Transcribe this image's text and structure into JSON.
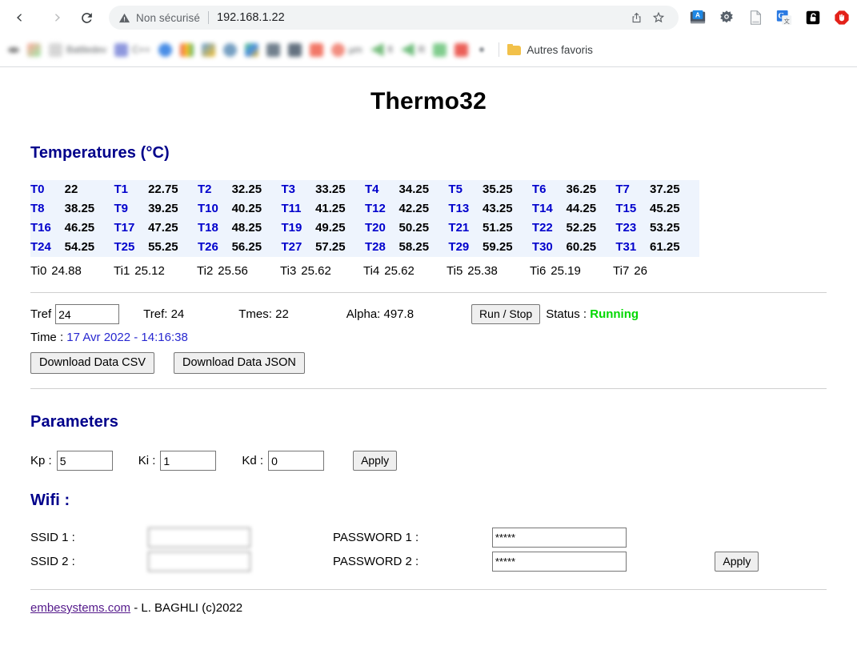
{
  "browser": {
    "nav": {
      "back_icon": "arrow-left-icon",
      "forward_icon": "arrow-right-icon",
      "reload_icon": "reload-icon"
    },
    "omnibox": {
      "warning_icon": "warning-triangle-icon",
      "security_text": "Non sécurisé",
      "url": "192.168.1.22",
      "share_icon": "share-icon",
      "bookmark_icon": "star-icon"
    },
    "extensions": [
      {
        "name": "grammar-extension-icon",
        "label": "A"
      },
      {
        "name": "bug-gear-extension-icon",
        "label": ""
      },
      {
        "name": "document-extension-icon",
        "label": ""
      },
      {
        "name": "google-translate-extension-icon",
        "label": "G"
      },
      {
        "name": "lock-extension-icon",
        "label": ""
      },
      {
        "name": "adblock-extension-icon",
        "label": ""
      },
      {
        "name": "privacy-badger-extension-icon",
        "label": ""
      },
      {
        "name": "puzzle-extensions-icon",
        "label": ""
      },
      {
        "name": "side-panel-icon",
        "label": ""
      }
    ],
    "profile_icon": "avatar",
    "menu_icon": "kebab-menu-icon",
    "bookmarks": [
      {
        "label": "",
        "color": "#6b6b6b"
      },
      {
        "label": "",
        "color": "#8fe39a"
      },
      {
        "label": "",
        "color": "#b9b9b9"
      },
      {
        "label": "Battledev",
        "color": "#9a9a9a"
      },
      {
        "label": "",
        "color": "#7b86d8"
      },
      {
        "label": "C++",
        "color": "#8b8b8b"
      },
      {
        "label": "",
        "color": "#2a7ae2"
      },
      {
        "label": "",
        "color": "#ea4335"
      },
      {
        "label": "",
        "color": "#4a90d9"
      },
      {
        "label": "",
        "color": "#5e8fb8"
      },
      {
        "label": "",
        "color": "#3dbf6e"
      },
      {
        "label": "",
        "color": "#5a6b7a"
      },
      {
        "label": "",
        "color": "#4a5a6a"
      },
      {
        "label": "",
        "color": "#f0604d"
      },
      {
        "label": "µm",
        "color": "#f07a6a"
      },
      {
        "label": "fl",
        "color": "#62b36a"
      },
      {
        "label": "R",
        "color": "#5bb36a"
      },
      {
        "label": "",
        "color": "#6bc47a"
      },
      {
        "label": "",
        "color": "#e8453c"
      }
    ],
    "other_bookmarks": {
      "icon": "folder-icon",
      "label": "Autres favoris"
    }
  },
  "page": {
    "title": "Thermo32",
    "temperatures": {
      "heading": "Temperatures (°C)",
      "sensors": [
        {
          "label": "T0",
          "value": "22"
        },
        {
          "label": "T1",
          "value": "22.75"
        },
        {
          "label": "T2",
          "value": "32.25"
        },
        {
          "label": "T3",
          "value": "33.25"
        },
        {
          "label": "T4",
          "value": "34.25"
        },
        {
          "label": "T5",
          "value": "35.25"
        },
        {
          "label": "T6",
          "value": "36.25"
        },
        {
          "label": "T7",
          "value": "37.25"
        },
        {
          "label": "T8",
          "value": "38.25"
        },
        {
          "label": "T9",
          "value": "39.25"
        },
        {
          "label": "T10",
          "value": "40.25"
        },
        {
          "label": "T11",
          "value": "41.25"
        },
        {
          "label": "T12",
          "value": "42.25"
        },
        {
          "label": "T13",
          "value": "43.25"
        },
        {
          "label": "T14",
          "value": "44.25"
        },
        {
          "label": "T15",
          "value": "45.25"
        },
        {
          "label": "T16",
          "value": "46.25"
        },
        {
          "label": "T17",
          "value": "47.25"
        },
        {
          "label": "T18",
          "value": "48.25"
        },
        {
          "label": "T19",
          "value": "49.25"
        },
        {
          "label": "T20",
          "value": "50.25"
        },
        {
          "label": "T21",
          "value": "51.25"
        },
        {
          "label": "T22",
          "value": "52.25"
        },
        {
          "label": "T23",
          "value": "53.25"
        },
        {
          "label": "T24",
          "value": "54.25"
        },
        {
          "label": "T25",
          "value": "55.25"
        },
        {
          "label": "T26",
          "value": "56.25"
        },
        {
          "label": "T27",
          "value": "57.25"
        },
        {
          "label": "T28",
          "value": "58.25"
        },
        {
          "label": "T29",
          "value": "59.25"
        },
        {
          "label": "T30",
          "value": "60.25"
        },
        {
          "label": "T31",
          "value": "61.25"
        }
      ],
      "internal": [
        {
          "label": "Ti0",
          "value": "24.88"
        },
        {
          "label": "Ti1",
          "value": "25.12"
        },
        {
          "label": "Ti2",
          "value": "25.56"
        },
        {
          "label": "Ti3",
          "value": "25.62"
        },
        {
          "label": "Ti4",
          "value": "25.62"
        },
        {
          "label": "Ti5",
          "value": "25.38"
        },
        {
          "label": "Ti6",
          "value": "25.19"
        },
        {
          "label": "Ti7",
          "value": "26"
        }
      ],
      "grid_columns": 8,
      "grid_rows": 4,
      "bg_color": "#eef4fd",
      "label_color": "#0000cc"
    },
    "control": {
      "tref_label": "Tref",
      "tref_input_value": "24",
      "tref_readout": "Tref: 24",
      "tmes_readout": "Tmes: 22",
      "alpha_readout": "Alpha: 497.8",
      "run_stop_label": "Run / Stop",
      "status_label": "Status :",
      "status_value": "Running",
      "status_color": "#00d800",
      "time_label": "Time :",
      "time_value": "17 Avr 2022 - 14:16:38",
      "time_color": "#2727d0",
      "download_csv_label": "Download Data CSV",
      "download_json_label": "Download Data JSON"
    },
    "parameters": {
      "heading": "Parameters",
      "kp_label": "Kp :",
      "kp_value": "5",
      "ki_label": "Ki :",
      "ki_value": "1",
      "kd_label": "Kd :",
      "kd_value": "0",
      "apply_label": "Apply"
    },
    "wifi": {
      "heading": "Wifi :",
      "ssid1_label": "SSID 1 :",
      "ssid1_value": "",
      "password1_label": "PASSWORD 1 :",
      "password1_value": "*****",
      "ssid2_label": "SSID 2 :",
      "ssid2_value": "",
      "password2_label": "PASSWORD 2 :",
      "password2_value": "*****",
      "apply_label": "Apply"
    },
    "footer": {
      "link_text": "embesystems.com",
      "rest_text": " - L. BAGHLI (c)2022",
      "link_color": "#551a8b"
    },
    "heading_color": "#00008b"
  }
}
